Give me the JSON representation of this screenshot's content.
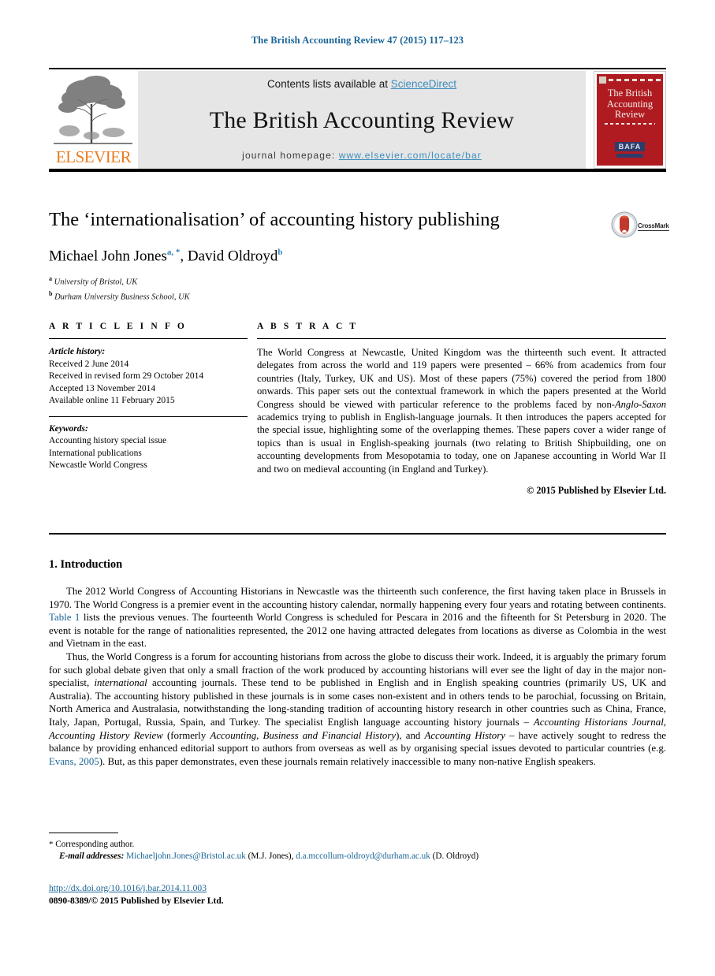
{
  "running_head": "The British Accounting Review 47 (2015) 117–123",
  "masthead": {
    "publisher_name": "ELSEVIER",
    "publisher_icon": "elsevier-tree-logo",
    "contents_prefix": "Contents lists available at ",
    "contents_link": "ScienceDirect",
    "journal_title": "The British Accounting Review",
    "homepage_prefix": "journal homepage: ",
    "homepage_url": "www.elsevier.com/locate/bar",
    "cover": {
      "title_line1": "The British",
      "title_line2": "Accounting",
      "title_line3": "Review",
      "society_badge": "BAFA",
      "background_color": "#b01b22"
    }
  },
  "article": {
    "title": "The ‘internationalisation’ of accounting history publishing",
    "authors": [
      {
        "name": "Michael John Jones",
        "marks": "a, *"
      },
      {
        "name": "David Oldroyd",
        "marks": "b"
      }
    ],
    "authors_joiner": ", ",
    "affiliations": [
      {
        "mark": "a",
        "text": "University of Bristol, UK"
      },
      {
        "mark": "b",
        "text": "Durham University Business School, UK"
      }
    ],
    "crossmark_label": "CrossMark"
  },
  "article_info": {
    "heading": "A R T I C L E   I N F O",
    "history_label": "Article history:",
    "history": [
      "Received 2 June 2014",
      "Received in revised form 29 October 2014",
      "Accepted 13 November 2014",
      "Available online 11 February 2015"
    ],
    "keywords_label": "Keywords:",
    "keywords": [
      "Accounting history special issue",
      "International publications",
      "Newcastle World Congress"
    ]
  },
  "abstract": {
    "heading": "A B S T R A C T",
    "text_html": "The World Congress at Newcastle, United Kingdom was the thirteenth such event. It attracted delegates from across the world and 119 papers were presented – 66% from academics from four countries (Italy, Turkey, UK and US). Most of these papers (75%) covered the period from 1800 onwards. This paper sets out the contextual framework in which the papers presented at the World Congress should be viewed with particular reference to the problems faced by non-<i>Anglo-Saxon</i> academics trying to publish in English-language journals. It then introduces the papers accepted for the special issue, highlighting some of the overlapping themes. These papers cover a wider range of topics than is usual in English-speaking journals (two relating to British Shipbuilding, one on accounting developments from Mesopotamia to today, one on Japanese accounting in World War II and two on medieval accounting (in England and Turkey).",
    "copyright": "© 2015 Published by Elsevier Ltd."
  },
  "body": {
    "section_number_title": "1.  Introduction",
    "paragraph1_html": "The 2012 World Congress of Accounting Historians in Newcastle was the thirteenth such conference, the first having taken place in Brussels in 1970. The World Congress is a premier event in the accounting history calendar, normally happening every four years and rotating between continents. <a class=\"ref\" href=\"#\" data-name=\"table-1-link\" data-interactable=\"true\">Table 1</a> lists the previous venues. The fourteenth World Congress is scheduled for Pescara in 2016 and the fifteenth for St Petersburg in 2020. The event is notable for the range of nationalities represented, the 2012 one having attracted delegates from locations as diverse as Colombia in the west and Vietnam in the east.",
    "paragraph2_html": "Thus, the World Congress is a forum for accounting historians from across the globe to discuss their work. Indeed, it is arguably the primary forum for such global debate given that only a small fraction of the work produced by accounting historians will ever see the light of day in the major non-specialist, <i>international</i> accounting journals. These tend to be published in English and in English speaking countries (primarily US, UK and Australia). The accounting history published in these journals is in some cases non-existent and in others tends to be parochial, focussing on Britain, North America and Australasia, notwithstanding the long-standing tradition of accounting history research in other countries such as China, France, Italy, Japan, Portugal, Russia, Spain, and Turkey. The specialist English language accounting history journals – <i>Accounting Historians Journal, Accounting History Review</i> (formerly <i>Accounting, Business and Financial History</i>), and <i>Accounting History</i> – have actively sought to redress the balance by providing enhanced editorial support to authors from overseas as well as by organising special issues devoted to particular countries (e.g. <a class=\"ref\" href=\"#\" data-name=\"evans-2005-citation-link\" data-interactable=\"true\">Evans, 2005</a>). But, as this paper demonstrates, even these journals remain relatively inaccessible to many non-native English speakers."
  },
  "footnote": {
    "corresponding_marker": "*",
    "corresponding_text": "Corresponding author.",
    "email_label": "E-mail addresses:",
    "emails": [
      {
        "address": "Michaeljohn.Jones@Bristol.ac.uk",
        "owner": "(M.J. Jones)"
      },
      {
        "address": "d.a.mccollum-oldroyd@durham.ac.uk",
        "owner": "(D. Oldroyd)"
      }
    ]
  },
  "footer": {
    "doi": "http://dx.doi.org/10.1016/j.bar.2014.11.003",
    "issn_copyright": "0890-8389/© 2015 Published by Elsevier Ltd."
  },
  "colors": {
    "link_blue": "#1a6496",
    "sciencedirect_blue": "#3c8dbc",
    "elsevier_orange": "#e87d1e",
    "banner_grey": "#e6e6e6",
    "cover_red": "#b01b22"
  }
}
